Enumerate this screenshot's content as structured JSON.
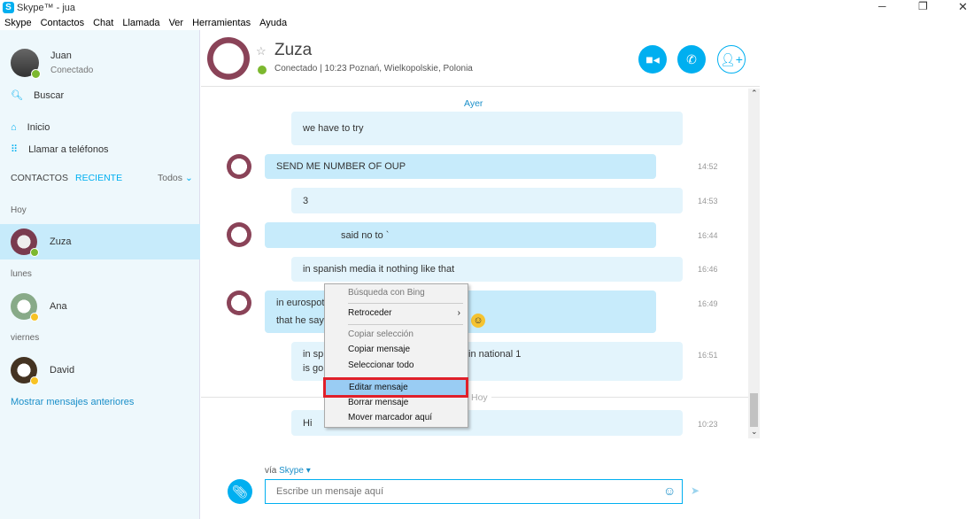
{
  "window": {
    "title": "Skype™ - jua",
    "controls": [
      "minimize",
      "restore",
      "close"
    ]
  },
  "menu": [
    "Skype",
    "Contactos",
    "Chat",
    "Llamada",
    "Ver",
    "Herramientas",
    "Ayuda"
  ],
  "profile": {
    "name": "Juan",
    "status": "Conectado"
  },
  "sidebar": {
    "search": "Buscar",
    "home": "Inicio",
    "call_phones": "Llamar a teléfonos",
    "tab_contacts": "CONTACTOS",
    "tab_recent": "RECIENTE",
    "filter": "Todos",
    "show_older": "Mostrar mensajes anteriores",
    "groups": [
      {
        "label": "Hoy",
        "contacts": [
          {
            "name": "Zuza",
            "status": "online"
          }
        ]
      },
      {
        "label": "lunes",
        "contacts": [
          {
            "name": "Ana",
            "status": "away"
          }
        ]
      },
      {
        "label": "viernes",
        "contacts": [
          {
            "name": "David",
            "status": "away"
          }
        ]
      }
    ]
  },
  "chat": {
    "name": "Zuza",
    "status": "Conectado",
    "location": "10:23 Poznań, Wielkopolskie, Polonia",
    "day_yesterday": "Ayer",
    "day_today": "Hoy",
    "messages": [
      {
        "text": "we have to try",
        "time": ""
      },
      {
        "text": "SEND ME NUMBER OF OUP",
        "time": "14:52"
      },
      {
        "text": "3",
        "time": "14:53"
      },
      {
        "text": "said no to `",
        "time": "16:44"
      },
      {
        "text": "in spanish media it nothing like that",
        "time": "16:46"
      },
      {
        "text": "in eurospot",
        "text2": "that he say",
        "time": "16:49"
      },
      {
        "text": "in sp",
        "text_b": "in national 1",
        "text2": "is go",
        "time": "16:51"
      },
      {
        "text": "Hi",
        "time": "10:23"
      }
    ],
    "via_label": "vía",
    "via_service": "Skype",
    "input_placeholder": "Escribe un mensaje aquí"
  },
  "context_menu": {
    "items": [
      "Búsqueda con Bing",
      "Retroceder",
      "Copiar selección",
      "Copiar mensaje",
      "Seleccionar todo",
      "Editar mensaje",
      "Borrar mensaje",
      "Mover marcador aquí"
    ],
    "highlighted": "Editar mensaje"
  },
  "colors": {
    "accent": "#00aff0",
    "highlight_border": "#e0202a",
    "online": "#7cb82f",
    "away": "#f7c325"
  }
}
